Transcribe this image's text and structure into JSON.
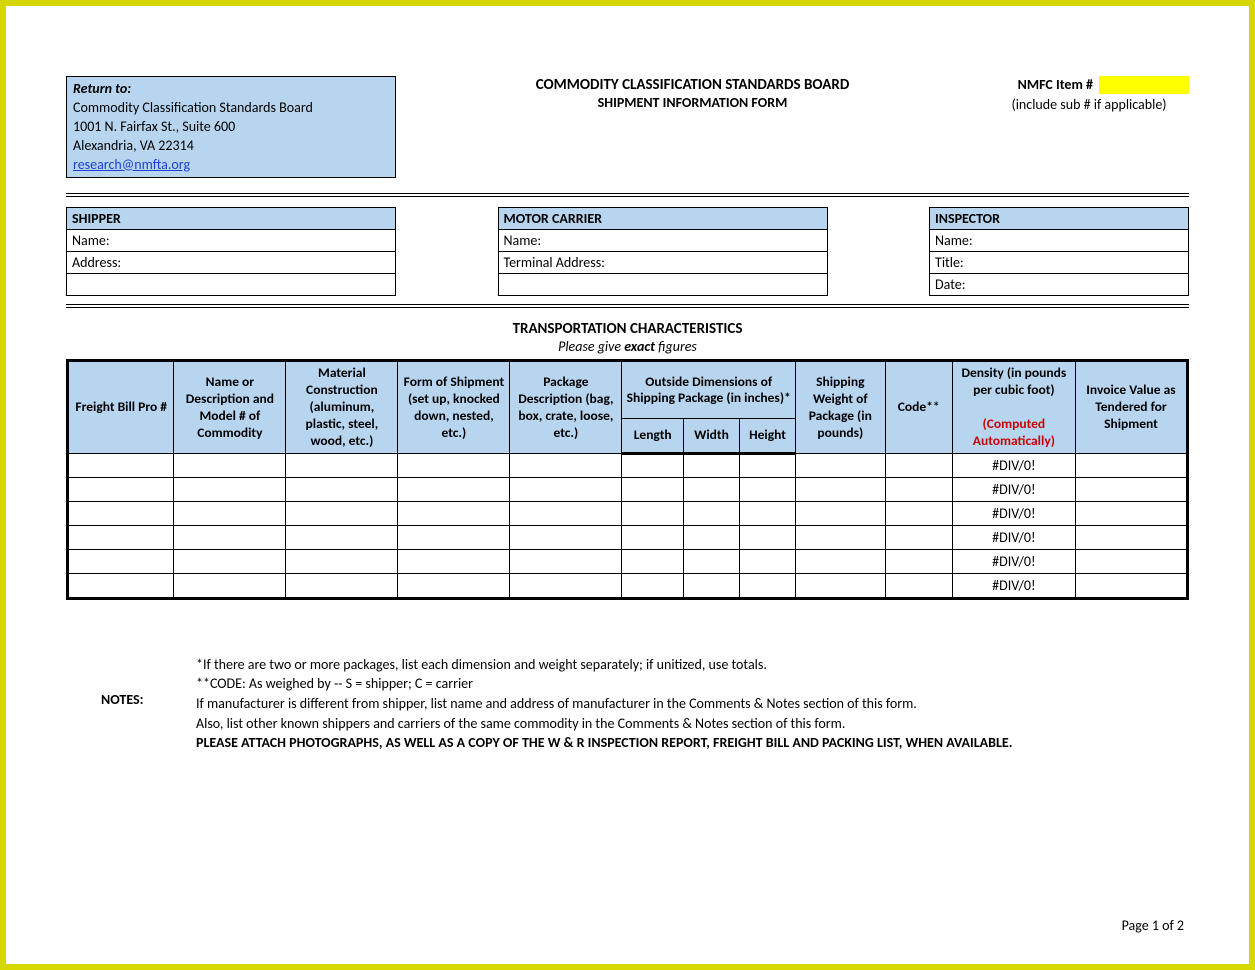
{
  "return_to": {
    "label": "Return to:",
    "org": "Commodity Classification Standards Board",
    "addr1": "1001 N. Fairfax St., Suite 600",
    "addr2": "Alexandria, VA 22314",
    "email": "research@nmfta.org"
  },
  "title": {
    "line1": "COMMODITY CLASSIFICATION STANDARDS BOARD",
    "line2": "SHIPMENT INFORMATION FORM"
  },
  "nmfc": {
    "label": "NMFC Item #",
    "value": "",
    "sub": "(include sub # if applicable)"
  },
  "shipper": {
    "header": "SHIPPER",
    "name_label": "Name:",
    "addr_label": "Address:"
  },
  "carrier": {
    "header": "MOTOR CARRIER",
    "name_label": "Name:",
    "addr_label": "Terminal Address:"
  },
  "inspector": {
    "header": "INSPECTOR",
    "name_label": "Name:",
    "title_label": "Title:",
    "date_label": "Date:"
  },
  "section": {
    "title": "TRANSPORTATION CHARACTERISTICS",
    "sub_prefix": "Please give ",
    "sub_exact": "exact",
    "sub_suffix": " figures"
  },
  "columns": {
    "freight": "Freight Bill Pro #",
    "name": "Name or Description and Model # of Commodity",
    "material": "Material Construction (aluminum, plastic, steel, wood, etc.)",
    "form": "Form of Shipment (set up, knocked down, nested, etc.)",
    "package": "Package Description (bag, box, crate, loose, etc.)",
    "outside": "Outside Dimensions of Shipping Package (in inches)*",
    "length": "Length",
    "width": "Width",
    "height": "Height",
    "weight": "Shipping Weight of Package (in pounds)",
    "code": "Code**",
    "density_top": "Density (in pounds per cubic foot)",
    "density_red": "(Computed Automatically)",
    "invoice": "Invoice Value as Tendered for Shipment"
  },
  "rows": [
    {
      "density": "#DIV/0!"
    },
    {
      "density": "#DIV/0!"
    },
    {
      "density": "#DIV/0!"
    },
    {
      "density": "#DIV/0!"
    },
    {
      "density": "#DIV/0!"
    },
    {
      "density": "#DIV/0!"
    }
  ],
  "notes": {
    "label": "NOTES:",
    "l1": "*If there are two or more packages, list each dimension and weight separately; if unitized, use totals.",
    "l2": "**CODE:  As weighed by  --  S = shipper;  C = carrier",
    "l3": "If manufacturer is different from shipper, list name and address of manufacturer in the Comments & Notes section of this form.",
    "l4": "Also, list other known shippers and carriers of the same commodity in the Comments & Notes section of this form.",
    "l5": "PLEASE ATTACH PHOTOGRAPHS, AS WELL AS A COPY OF THE W & R INSPECTION REPORT, FREIGHT BILL AND PACKING LIST, WHEN AVAILABLE."
  },
  "page_num": "Page 1 of 2"
}
